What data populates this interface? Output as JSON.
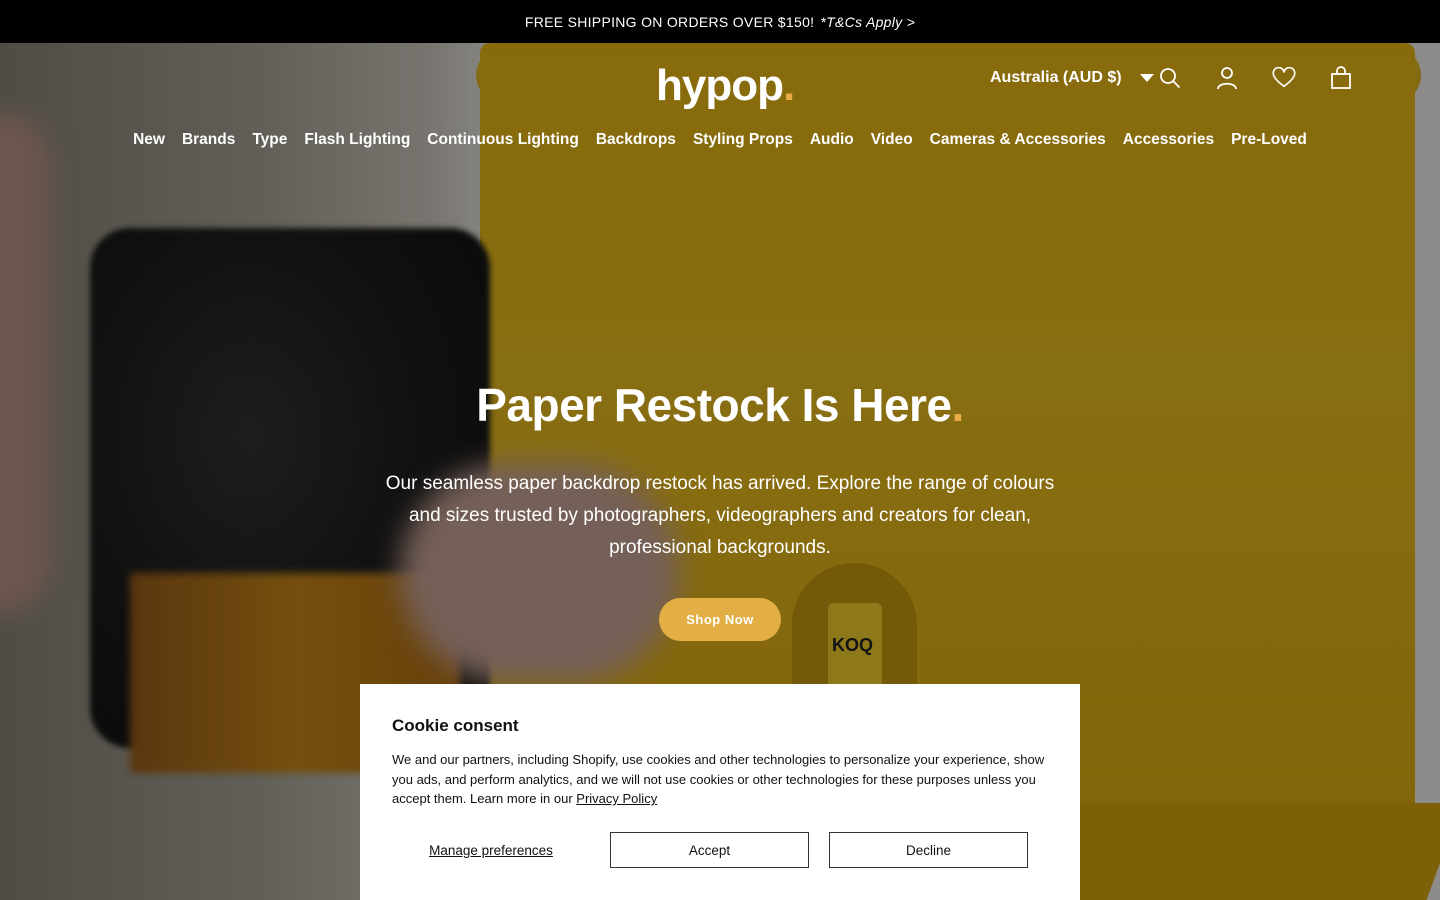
{
  "announcement": {
    "text": "FREE SHIPPING ON ORDERS OVER $150!",
    "link": "*T&Cs Apply >"
  },
  "header": {
    "logo_text": "hypop",
    "logo_dot": ".",
    "country_selector": "Australia (AUD $)",
    "icons": [
      "search-icon",
      "account-icon",
      "wishlist-heart-icon",
      "cart-bag-icon"
    ]
  },
  "nav": {
    "items": [
      {
        "label": "New"
      },
      {
        "label": "Brands"
      },
      {
        "label": "Type"
      },
      {
        "label": "Flash Lighting"
      },
      {
        "label": "Continuous Lighting"
      },
      {
        "label": "Backdrops"
      },
      {
        "label": "Styling Props"
      },
      {
        "label": "Audio"
      },
      {
        "label": "Video"
      },
      {
        "label": "Cameras & Accessories"
      },
      {
        "label": "Accessories"
      },
      {
        "label": "Pre-Loved"
      }
    ]
  },
  "hero": {
    "title": "Paper Restock Is Here",
    "title_dot": ".",
    "description": "Our seamless paper backdrop restock has arrived. Explore the range of colours and sizes trusted by photographers, videographers and creators for clean, professional backgrounds.",
    "cta": "Shop Now",
    "product_label": "KOQ"
  },
  "cookie": {
    "title": "Cookie consent",
    "body": "We and our partners, including Shopify, use cookies and other technologies to personalize your experience, show you ads, and perform analytics, and we will not use cookies or other technologies for these purposes unless you accept them. Learn more in our",
    "privacy_link": "Privacy Policy",
    "manage": "Manage preferences",
    "accept": "Accept",
    "decline": "Decline"
  },
  "colors": {
    "accent": "#e8ad45",
    "button": "#e3ae44",
    "announcement_bg": "#000000",
    "backdrop_yellow": "#e8b814"
  }
}
